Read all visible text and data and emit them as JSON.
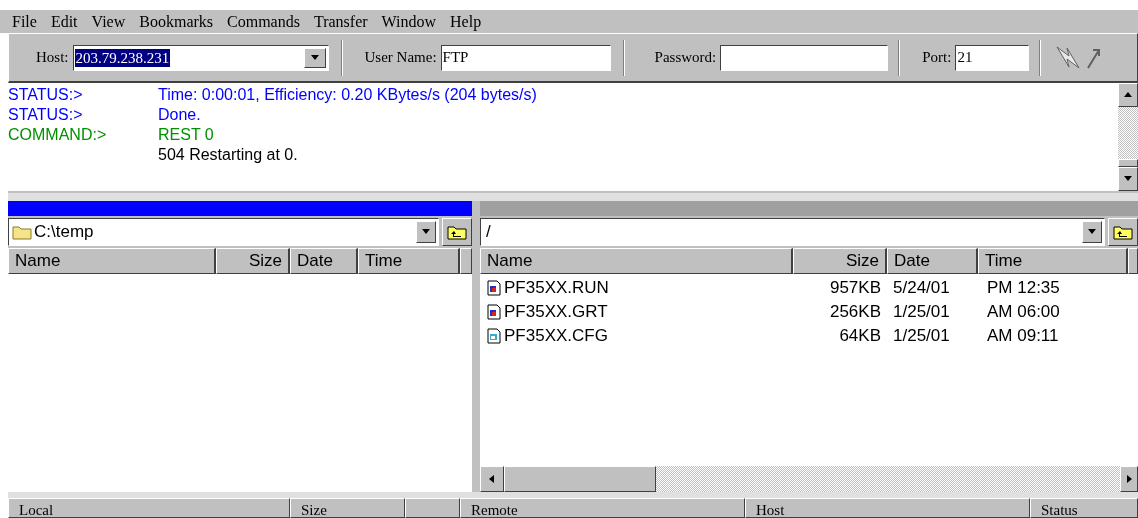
{
  "menu": [
    "File",
    "Edit",
    "View",
    "Bookmarks",
    "Commands",
    "Transfer",
    "Window",
    "Help"
  ],
  "connection": {
    "host_label": "Host:",
    "host": "203.79.238.231",
    "user_label": "User Name:",
    "user": "FTP",
    "password_label": "Password:",
    "port_label": "Port:",
    "port": "21"
  },
  "log": [
    {
      "kind": "status",
      "label": "STATUS:>",
      "message": "Time: 0:00:01, Efficiency: 0.20 KBytes/s (204 bytes/s)"
    },
    {
      "kind": "status",
      "label": "STATUS:>",
      "message": "Done."
    },
    {
      "kind": "command",
      "label": "COMMAND:>",
      "message": "REST 0"
    },
    {
      "kind": "response",
      "message": "504 Restarting at 0."
    }
  ],
  "panes": [
    {
      "kind": "local",
      "active": true,
      "path": "C:\\temp",
      "columns": [
        "Name",
        "Size",
        "Date",
        "Time"
      ]
    },
    {
      "kind": "remote",
      "active": false,
      "path": "/",
      "columns": [
        "Name",
        "Size",
        "Date",
        "Time"
      ],
      "files": [
        {
          "kind": "program",
          "name": "PF35XX.RUN",
          "size": "957KB",
          "date": "5/24/01",
          "time": "PM 12:35"
        },
        {
          "kind": "program",
          "name": "PF35XX.GRT",
          "size": "256KB",
          "date": "1/25/01",
          "time": "AM 06:00"
        },
        {
          "kind": "config",
          "name": "PF35XX.CFG",
          "size": "64KB",
          "date": "1/25/01",
          "time": "AM 09:11"
        }
      ]
    }
  ],
  "queue": {
    "columns": [
      "Local",
      "Size",
      "Remote",
      "Host",
      "Status"
    ]
  }
}
